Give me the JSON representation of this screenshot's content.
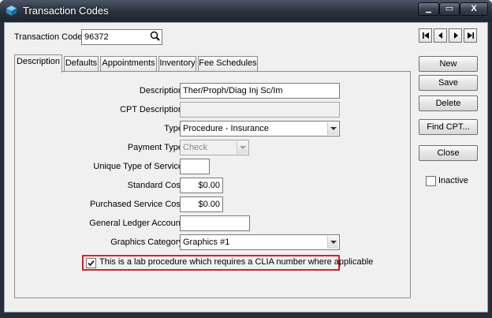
{
  "window": {
    "title": "Transaction Codes",
    "controls": {
      "minimize": "▁",
      "maximize": "▭",
      "close": "X"
    }
  },
  "header": {
    "code_label": "Transaction Code:",
    "code_value": "96372",
    "search_icon": "magnifier-icon",
    "nav": [
      "first-record",
      "previous-record",
      "next-record",
      "last-record"
    ]
  },
  "tabs": [
    {
      "label": "Description",
      "active": true
    },
    {
      "label": "Defaults"
    },
    {
      "label": "Appointments"
    },
    {
      "label": "Inventory"
    },
    {
      "label": "Fee Schedules"
    }
  ],
  "form": {
    "description_label": "Description:",
    "description_value": "Ther/Proph/Diag Inj Sc/Im",
    "cpt_label": "CPT Description:",
    "cpt_value": "",
    "type_label": "Type:",
    "type_value": "Procedure - Insurance",
    "payment_label": "Payment Type:",
    "payment_value": "Check",
    "unique_label": "Unique Type of Service:",
    "unique_value": "",
    "standard_label": "Standard Cost:",
    "standard_value": "$0.00",
    "purchased_label": "Purchased Service Cost:",
    "purchased_value": "$0.00",
    "gl_label": "General Ledger Account:",
    "gl_value": "",
    "graphics_label": "Graphics Category:",
    "graphics_value": "Graphics #1",
    "clia_label": "This is a lab procedure which requires a CLIA number where applicable",
    "clia_checked": true
  },
  "buttons": {
    "new": "New",
    "save": "Save",
    "delete": "Delete",
    "find_cpt": "Find CPT...",
    "close": "Close",
    "inactive_label": "Inactive",
    "inactive_checked": false
  },
  "colors": {
    "titlebar": "#2a313d",
    "highlight": "#d2232a",
    "panel": "#f0f0f0"
  }
}
